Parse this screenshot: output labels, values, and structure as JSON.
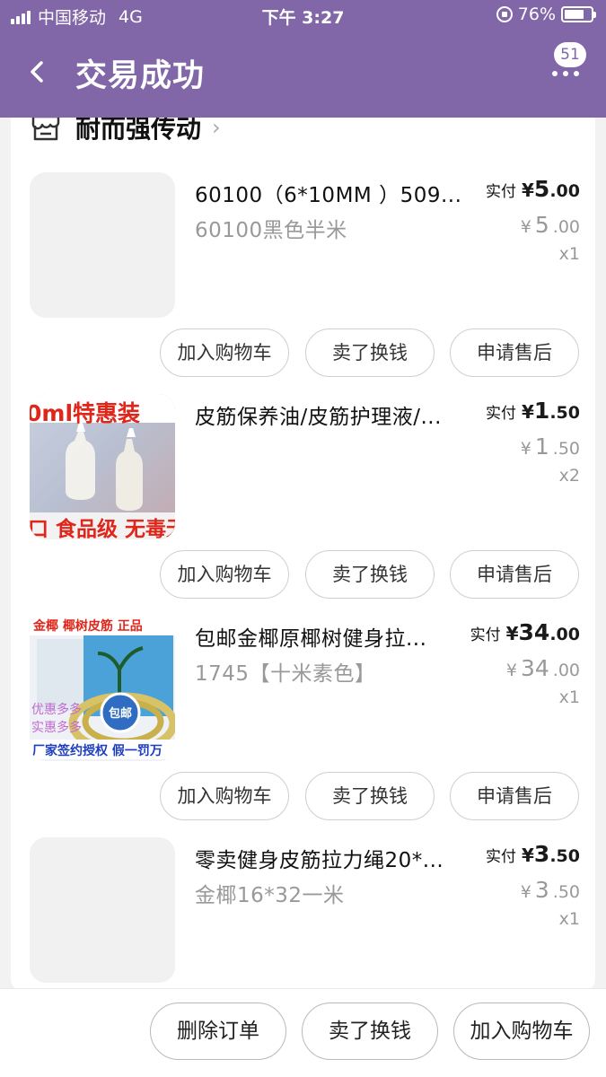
{
  "status_bar": {
    "carrier": "中国移动",
    "network": "4G",
    "time": "下午 3:27",
    "battery_text": "76%",
    "battery_level": 0.76
  },
  "nav": {
    "title": "交易成功",
    "back_icon": "chevron-left-icon",
    "message_badge": "51",
    "more_icon": "more-dots-icon"
  },
  "shop": {
    "name": "耐而强传动",
    "icon": "store-icon"
  },
  "items": [
    {
      "title": "60100（6*10MM ）509...",
      "sku": "60100黑色半米",
      "paid_label": "实付",
      "currency": "¥",
      "paid_int": "5",
      "paid_dec": ".00",
      "orig_int": "5",
      "orig_dec": ".00",
      "qty": "x1",
      "thumb": "placeholder"
    },
    {
      "title": "皮筋保养油/皮筋护理液/...",
      "sku": "",
      "paid_label": "实付",
      "currency": "¥",
      "paid_int": "1",
      "paid_dec": ".50",
      "orig_int": "1",
      "orig_dec": ".50",
      "qty": "x2",
      "thumb": "oil-bottles",
      "thumb_text_top": "0ml特惠装",
      "thumb_text_bottom": "口 食品级 无毒无"
    },
    {
      "title": "包邮金椰原椰树健身拉...",
      "sku": "1745【十米素色】",
      "paid_label": "实付",
      "currency": "¥",
      "paid_int": "34",
      "paid_dec": ".00",
      "orig_int": "34",
      "orig_dec": ".00",
      "qty": "x1",
      "thumb": "rubber-tube",
      "thumb_text_top": "金椰 椰树皮筋 正品",
      "thumb_text_side1": "优惠多多",
      "thumb_text_side2": "实惠多多",
      "thumb_text_bottom": "厂家签约授权 假一罚万",
      "thumb_badge": "包邮"
    },
    {
      "title": "零卖健身皮筋拉力绳20*...",
      "sku": "金椰16*32一米",
      "paid_label": "实付",
      "currency": "¥",
      "paid_int": "3",
      "paid_dec": ".50",
      "orig_int": "3",
      "orig_dec": ".50",
      "qty": "x1",
      "thumb": "placeholder"
    }
  ],
  "item_actions": {
    "add_cart": "加入购物车",
    "resell": "卖了换钱",
    "after_sale": "申请售后"
  },
  "bottom_bar": {
    "delete_order": "删除订单",
    "resell": "卖了换钱",
    "add_cart": "加入购物车"
  },
  "colors": {
    "header_bg": "#8166a8",
    "page_bg": "#f2f2f2",
    "muted_text": "#999999"
  }
}
